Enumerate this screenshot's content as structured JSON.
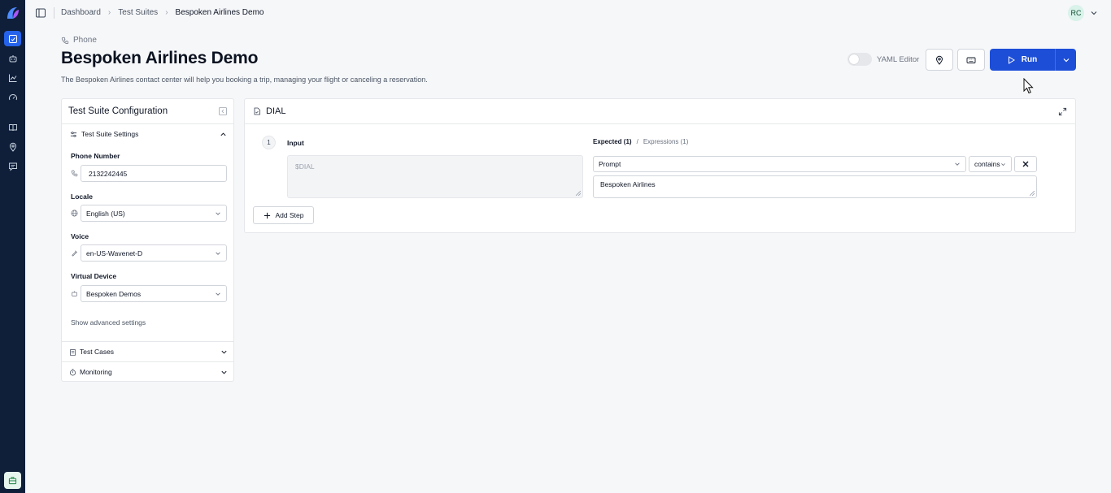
{
  "colors": {
    "rail_bg": "#0f1f3a",
    "accent": "#1d4ed8",
    "avatar_bg": "#d9f2ea"
  },
  "rail": {
    "icons": [
      "app-logo",
      "test-suites-icon",
      "bot-icon",
      "chart-icon",
      "gauge-icon",
      "book-icon",
      "location-icon",
      "message-icon"
    ],
    "bottom_icon": "briefcase-icon"
  },
  "breadcrumb": {
    "items": [
      "Dashboard",
      "Test Suites"
    ],
    "current": "Bespoken Airlines Demo"
  },
  "user": {
    "initials": "RC"
  },
  "header": {
    "kind": "Phone",
    "title": "Bespoken Airlines Demo",
    "description": "The Bespoken Airlines contact center will help you booking a trip, managing your flight or canceling a reservation.",
    "yaml_label": "YAML Editor",
    "run_label": "Run"
  },
  "config": {
    "title": "Test Suite Configuration",
    "settings_label": "Test Suite Settings",
    "phone_label": "Phone Number",
    "phone_value": "2132242445",
    "locale_label": "Locale",
    "locale_value": "English (US)",
    "voice_label": "Voice",
    "voice_value": "en-US-Wavenet-D",
    "device_label": "Virtual Device",
    "device_value": "Bespoken Demos",
    "advanced_label": "Show advanced settings",
    "test_cases_label": "Test Cases",
    "monitoring_label": "Monitoring"
  },
  "step_panel": {
    "title": "DIAL",
    "step_number": "1",
    "input_label": "Input",
    "input_value": "$DIAL",
    "expected_tab": "Expected (1)",
    "slash": "/",
    "expressions_tab": "Expressions (1)",
    "field_value": "Prompt",
    "operator_value": "contains",
    "expected_value": "Bespoken Airlines",
    "add_step_label": "Add Step"
  }
}
